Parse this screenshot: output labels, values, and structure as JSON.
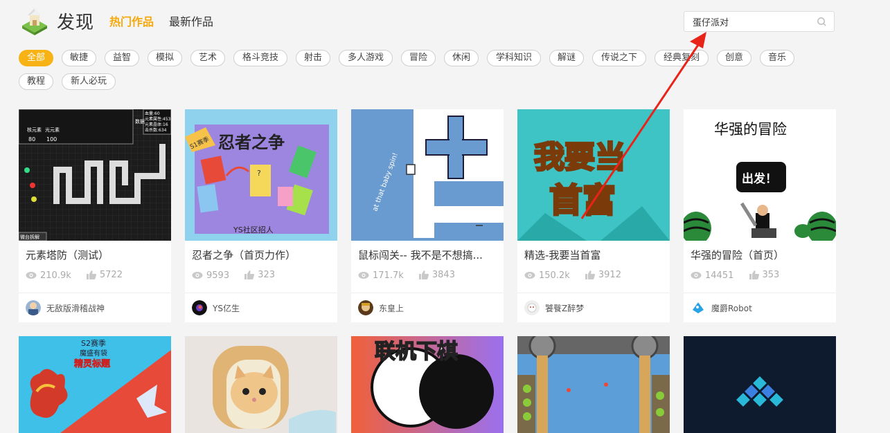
{
  "header": {
    "title": "发现",
    "tab_hot": "热门作品",
    "tab_new": "最新作品",
    "search_value": "蛋仔派对"
  },
  "categories": [
    "全部",
    "敏捷",
    "益智",
    "模拟",
    "艺术",
    "格斗竞技",
    "射击",
    "多人游戏",
    "冒险",
    "休闲",
    "学科知识",
    "解谜",
    "传说之下",
    "经典复刻",
    "创意",
    "音乐",
    "教程",
    "新人必玩"
  ],
  "cards": [
    {
      "title": "元素塔防（测试）",
      "views": "210.9k",
      "likes": "5722",
      "author": "无敌版滑稽战神",
      "thumb_text": {
        "r1": "血量:60",
        "r2": "元素属性:453",
        "r3": "元素晶体:16",
        "r4": "击杀数:634",
        "label_a": "数据",
        "label_b": "核元素",
        "label_c": "光元素",
        "num_a": "80",
        "num_b": "100",
        "bottom": "微台拆解"
      }
    },
    {
      "title": "忍者之争（首页力作）",
      "views": "9593",
      "likes": "323",
      "author": "YS亿生",
      "thumb_text": {
        "big": "忍者之争",
        "badge": "S1赛季",
        "sub": "YS社区招人",
        "q": "?"
      }
    },
    {
      "title": "鼠标闯关-- 我不是不想搞...",
      "views": "171.7k",
      "likes": "3843",
      "author": "东皇上",
      "thumb_text": {
        "side": "at that baby spin!"
      }
    },
    {
      "title": "精选-我要当首富",
      "views": "150.2k",
      "likes": "3912",
      "author": "饕餮Z醉梦",
      "thumb_text": {
        "l1": "我要当",
        "l2": "首富"
      }
    },
    {
      "title": "华强的冒险（首页）",
      "views": "14451",
      "likes": "353",
      "author": "魔爵Robot",
      "thumb_text": {
        "title": "华强的冒险",
        "go": "出发！"
      }
    }
  ],
  "row2": [
    {
      "top": "S2赛季",
      "mid": "魔盛有袋",
      "big": "精灵标题"
    },
    {},
    {
      "text": "联机下棋"
    },
    {},
    {}
  ],
  "colors": {
    "accent": "#f7b316",
    "accent_text": "#f7a80a",
    "arrow": "#e8241a"
  }
}
